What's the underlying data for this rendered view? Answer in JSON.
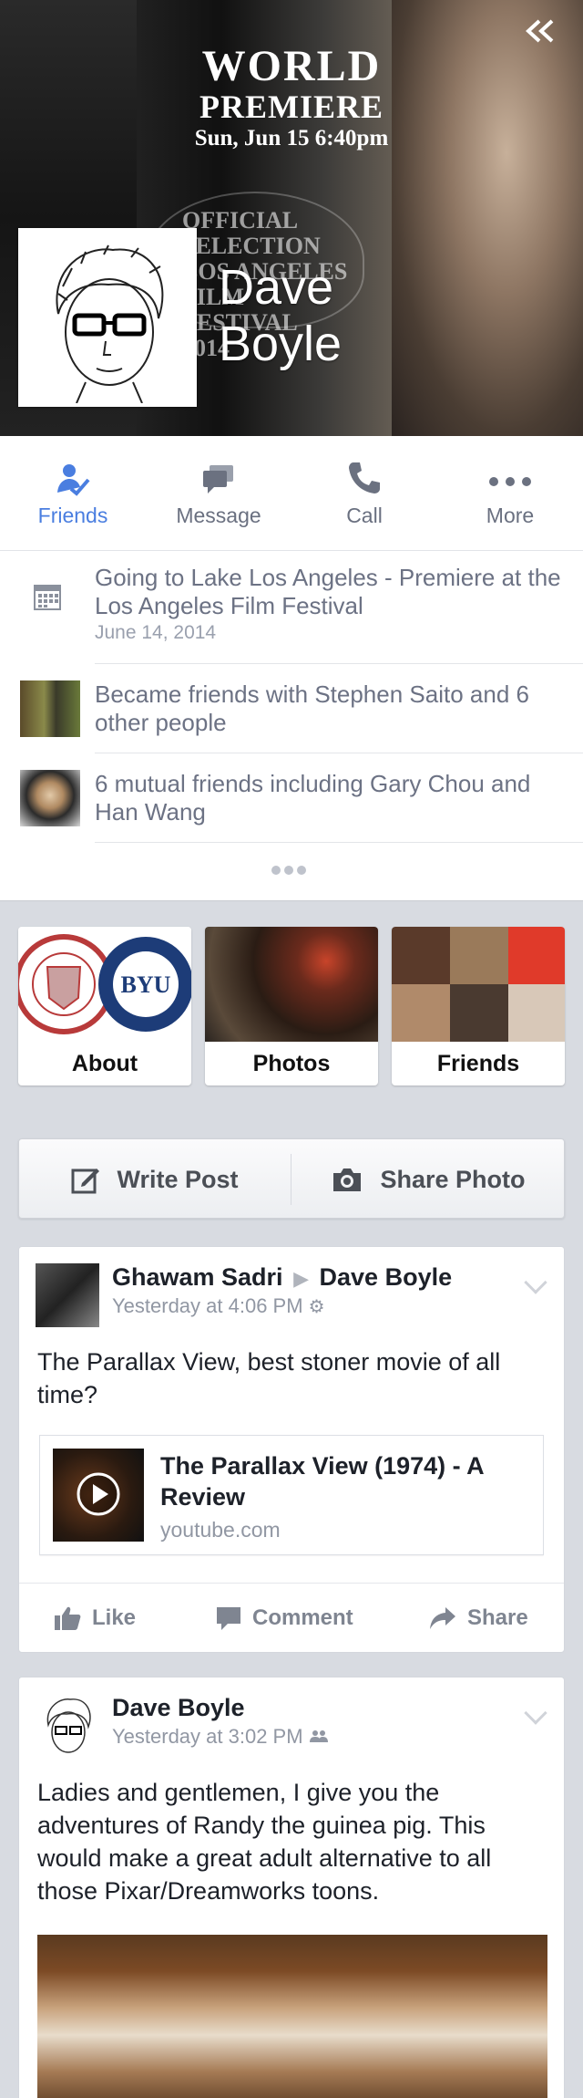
{
  "cover": {
    "poster_line1": "WORLD",
    "poster_line2": "PREMIERE",
    "poster_line3": "Sun, Jun 15 6:40pm",
    "laurel_text": "OFFICIAL\nSELECTION\nLOS ANGELES\nFILM FESTIVAL\n2014",
    "collapse_icon": "double-chevron-left-icon"
  },
  "profile": {
    "first_name": "Dave",
    "last_name": "Boyle"
  },
  "actions": [
    {
      "label": "Friends",
      "icon": "friends-check-icon",
      "active": true
    },
    {
      "label": "Message",
      "icon": "message-icon",
      "active": false
    },
    {
      "label": "Call",
      "icon": "phone-icon",
      "active": false
    },
    {
      "label": "More",
      "icon": "more-dots-icon",
      "active": false
    }
  ],
  "activity": [
    {
      "icon": "calendar-icon",
      "text": "Going to Lake Los Angeles - Premiere at the Los Angeles Film Festival",
      "sub": "June 14, 2014"
    },
    {
      "icon": "friend-photo",
      "text": "Became friends with Stephen Saito and 6 other people"
    },
    {
      "icon": "mutual-friend-photo",
      "text": "6 mutual friends including Gary Chou and Han Wang"
    }
  ],
  "tiles": [
    {
      "label": "About"
    },
    {
      "label": "Photos"
    },
    {
      "label": "Friends"
    }
  ],
  "composer": {
    "write_post": "Write Post",
    "share_photo": "Share Photo"
  },
  "posts": [
    {
      "author": "Ghawam Sadri",
      "target": "Dave Boyle",
      "time": "Yesterday at 4:06 PM",
      "text": "The Parallax View, best stoner movie of all time?",
      "link_title": "The Parallax View (1974) - A Review",
      "link_url": "youtube.com",
      "like": "Like",
      "comment": "Comment",
      "share": "Share"
    },
    {
      "author": "Dave Boyle",
      "time": "Yesterday at 3:02 PM",
      "text": "Ladies and gentlemen, I give you the adventures of Randy the guinea pig.  This would make a great adult alternative to all those Pixar/Dreamworks toons."
    }
  ],
  "colors": {
    "accent": "#4a7ee0",
    "background": "#d8dbe1"
  }
}
